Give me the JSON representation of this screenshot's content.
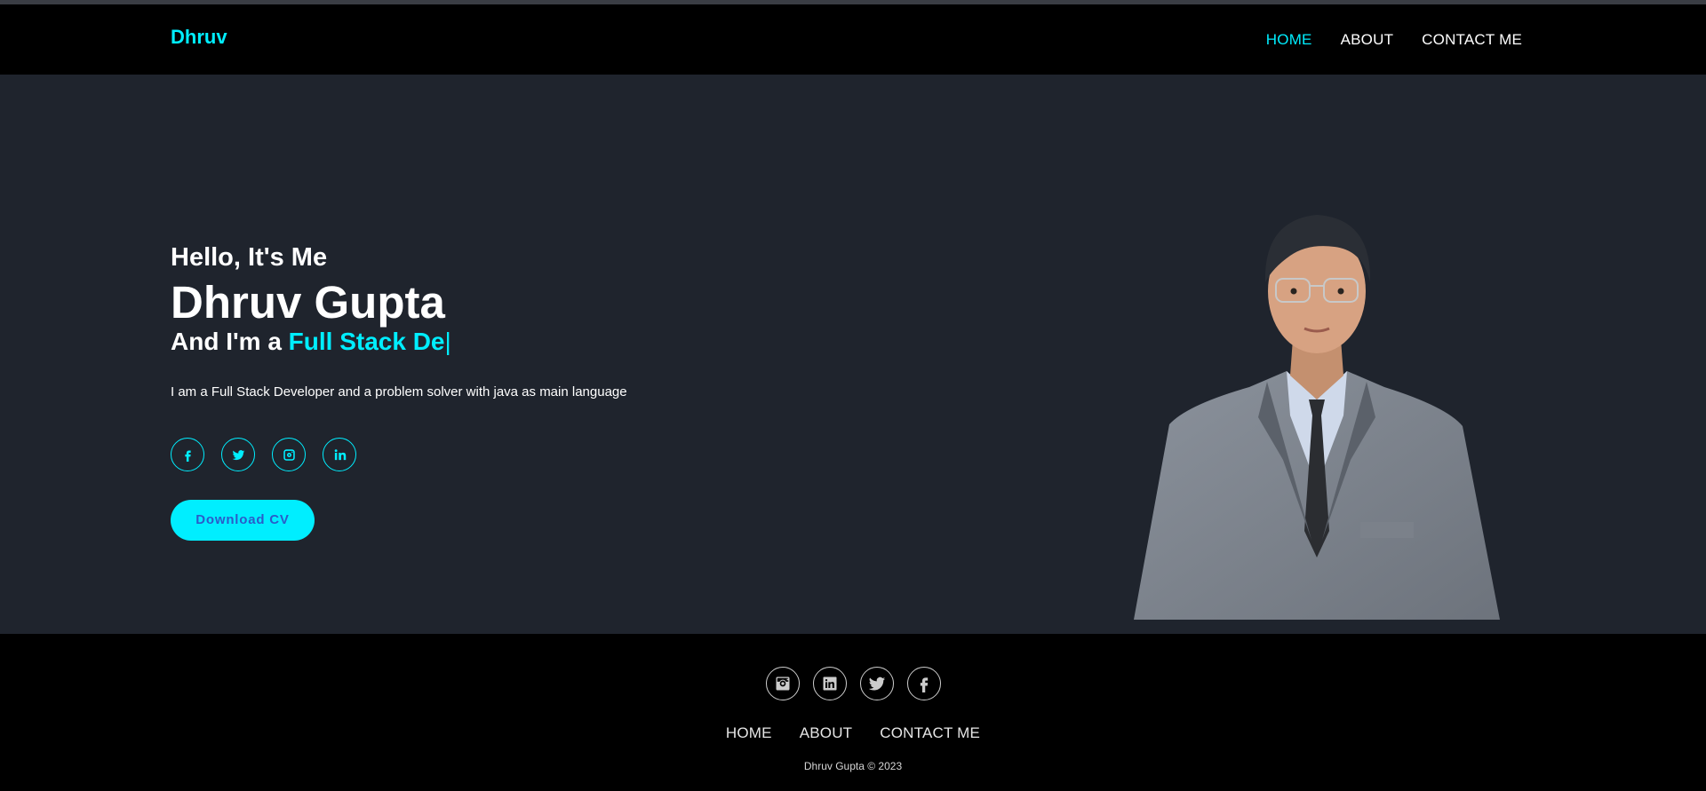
{
  "header": {
    "logo": "Dhruv",
    "nav": [
      {
        "label": "HOME",
        "active": true
      },
      {
        "label": "ABOUT",
        "active": false
      },
      {
        "label": "CONTACT ME",
        "active": false
      }
    ]
  },
  "hero": {
    "greeting": "Hello, It's Me",
    "name": "Dhruv Gupta",
    "role_prefix": "And I'm a ",
    "role_typed": "Full Stack De",
    "caret": "|",
    "description": "I am a Full Stack Developer and a problem solver with java as main language",
    "socials": [
      "facebook-icon",
      "twitter-icon",
      "instagram-icon",
      "linkedin-icon"
    ],
    "cv_button": "Download CV"
  },
  "footer": {
    "socials": [
      "instagram-icon",
      "linkedin-icon",
      "twitter-icon",
      "facebook-icon"
    ],
    "nav": [
      "HOME",
      "ABOUT",
      "CONTACT ME"
    ],
    "copyright": "Dhruv Gupta © 2023"
  },
  "colors": {
    "accent": "#00eeff",
    "background": "#1f242d",
    "header_footer": "#000000",
    "text": "#ffffff"
  }
}
